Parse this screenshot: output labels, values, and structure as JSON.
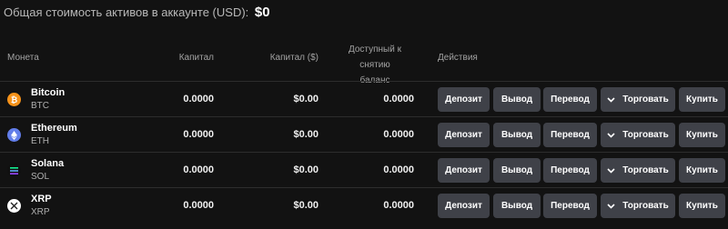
{
  "summary": {
    "label": "Общая стоимость активов в аккаунте (USD):",
    "total": "$0"
  },
  "columns": {
    "coin": "Монета",
    "capital": "Капитал",
    "capital_usd": "Капитал ($)",
    "available_line1": "Доступный к снятию",
    "available_line2": "баланс",
    "actions": "Действия"
  },
  "actions": {
    "deposit": "Депозит",
    "withdraw": "Вывод",
    "transfer": "Перевод",
    "trade": "Торговать",
    "buy": "Купить"
  },
  "assets": [
    {
      "name": "Bitcoin",
      "symbol": "BTC",
      "capital": "0.0000",
      "capital_usd": "$0.00",
      "available": "0.0000",
      "icon": "bitcoin-icon",
      "color": "#f7931a"
    },
    {
      "name": "Ethereum",
      "symbol": "ETH",
      "capital": "0.0000",
      "capital_usd": "$0.00",
      "available": "0.0000",
      "icon": "ethereum-icon",
      "color": "#627eea"
    },
    {
      "name": "Solana",
      "symbol": "SOL",
      "capital": "0.0000",
      "capital_usd": "$0.00",
      "available": "0.0000",
      "icon": "solana-icon",
      "color": "#14f195"
    },
    {
      "name": "XRP",
      "symbol": "XRP",
      "capital": "0.0000",
      "capital_usd": "$0.00",
      "available": "0.0000",
      "icon": "xrp-icon",
      "color": "#ffffff"
    }
  ]
}
